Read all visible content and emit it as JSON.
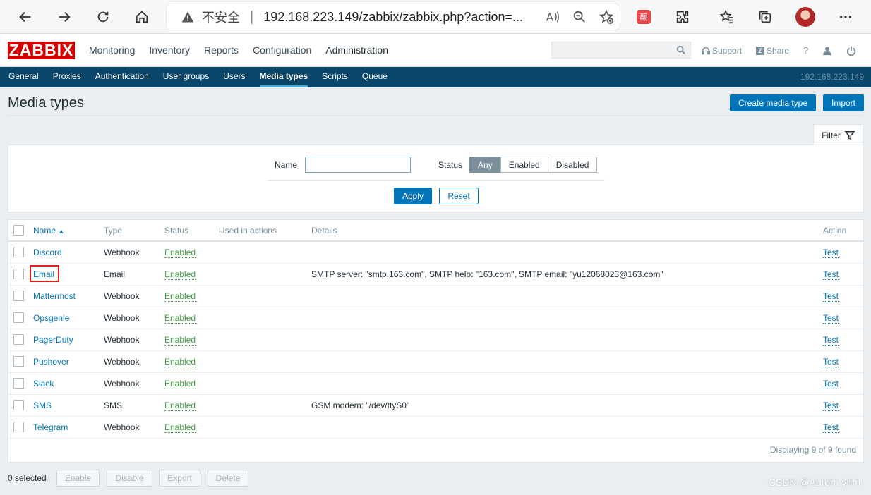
{
  "browser": {
    "insecure_label": "不安全",
    "url_main": "192.168.223.149/zabbix/zabbix.php?action=..."
  },
  "header": {
    "logo": "ZABBIX",
    "menu": [
      "Monitoring",
      "Inventory",
      "Reports",
      "Configuration",
      "Administration"
    ],
    "support": "Support",
    "share": "Share",
    "help": "?"
  },
  "subnav": {
    "items": [
      "General",
      "Proxies",
      "Authentication",
      "User groups",
      "Users",
      "Media types",
      "Scripts",
      "Queue"
    ],
    "active": "Media types",
    "server_ip": "192.168.223.149"
  },
  "page": {
    "title": "Media types",
    "create_button": "Create media type",
    "import_button": "Import"
  },
  "filter": {
    "tab_label": "Filter",
    "name_label": "Name",
    "name_value": "",
    "status_label": "Status",
    "status_options": [
      "Any",
      "Enabled",
      "Disabled"
    ],
    "status_selected": "Any",
    "apply": "Apply",
    "reset": "Reset"
  },
  "table": {
    "headers": {
      "name": "Name",
      "sort_indicator": "▲",
      "type": "Type",
      "status": "Status",
      "used": "Used in actions",
      "details": "Details",
      "action": "Action"
    },
    "rows": [
      {
        "name": "Discord",
        "type": "Webhook",
        "status": "Enabled",
        "details": "",
        "action": "Test"
      },
      {
        "name": "Email",
        "type": "Email",
        "status": "Enabled",
        "details": "SMTP server: \"smtp.163.com\", SMTP helo: \"163.com\", SMTP email: \"yu12068023@163.com\"",
        "action": "Test"
      },
      {
        "name": "Mattermost",
        "type": "Webhook",
        "status": "Enabled",
        "details": "",
        "action": "Test"
      },
      {
        "name": "Opsgenie",
        "type": "Webhook",
        "status": "Enabled",
        "details": "",
        "action": "Test"
      },
      {
        "name": "PagerDuty",
        "type": "Webhook",
        "status": "Enabled",
        "details": "",
        "action": "Test"
      },
      {
        "name": "Pushover",
        "type": "Webhook",
        "status": "Enabled",
        "details": "",
        "action": "Test"
      },
      {
        "name": "Slack",
        "type": "Webhook",
        "status": "Enabled",
        "details": "",
        "action": "Test"
      },
      {
        "name": "SMS",
        "type": "SMS",
        "status": "Enabled",
        "details": "GSM modem: \"/dev/ttyS0\"",
        "action": "Test"
      },
      {
        "name": "Telegram",
        "type": "Webhook",
        "status": "Enabled",
        "details": "",
        "action": "Test"
      }
    ],
    "footer": "Displaying 9 of 9 found"
  },
  "bottom": {
    "selected": "0 selected",
    "enable": "Enable",
    "disable": "Disable",
    "export": "Export",
    "delete": "Delete"
  },
  "watermark": "CSDN @Aurora yhm",
  "colors": {
    "brand": "#d40000",
    "subnav": "#0a466a",
    "primary": "#0275b8",
    "enabled": "#429e47",
    "highlight": "#e21f1f"
  }
}
